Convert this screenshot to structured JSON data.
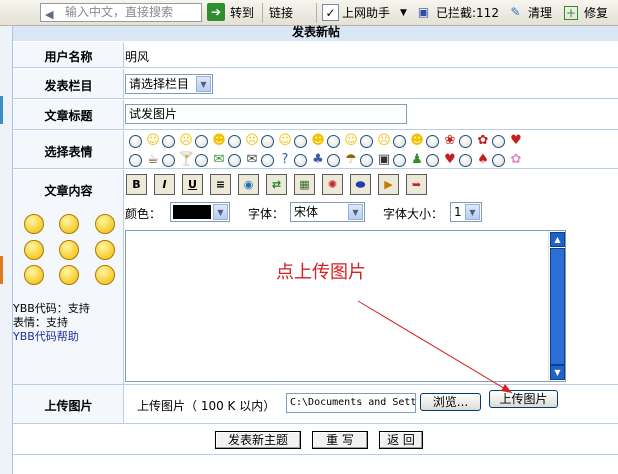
{
  "toolbar": {
    "search_placeholder": "输入中文，直接搜索",
    "go_label": "转到",
    "links_label": "链接",
    "helper_label": "上网助手",
    "blocked_label": "已拦截:112",
    "clean_label": "清理",
    "repair_label": "修复"
  },
  "form": {
    "title": "发表新帖",
    "username_label": "用户名称",
    "username_value": "明风",
    "category_label": "发表栏目",
    "category_selected": "请选择栏目",
    "article_title_label": "文章标题",
    "article_title_value": "试发图片",
    "emotion_label": "选择表情",
    "content_label": "文章内容",
    "toolbar_buttons": [
      "B",
      "I",
      "U",
      "≡",
      "",
      "",
      "",
      "",
      "",
      "",
      "",
      ""
    ],
    "color_label": "颜色：",
    "font_label": "字体：",
    "font_selected": "宋体",
    "fontsize_label": "字体大小：",
    "fontsize_selected": "1",
    "ybb_status": "YBB代码：支持",
    "emotion_status": "表情：支持",
    "ybb_help_link": "YBB代码帮助",
    "upload_label": "上传图片",
    "upload_desc": "上传图片（ 100 K 以内）",
    "upload_path": "C:\\Documents and Sett",
    "browse_button": "浏览...",
    "upload_button": "上传图片",
    "submit_button": "发表新主题",
    "reset_button": "重 写",
    "back_button": "返 回"
  },
  "annotation": "点上传图片",
  "colors": {
    "accent": "#d42020",
    "header_bg": "#d9e6f5",
    "border": "#b7cde8"
  }
}
